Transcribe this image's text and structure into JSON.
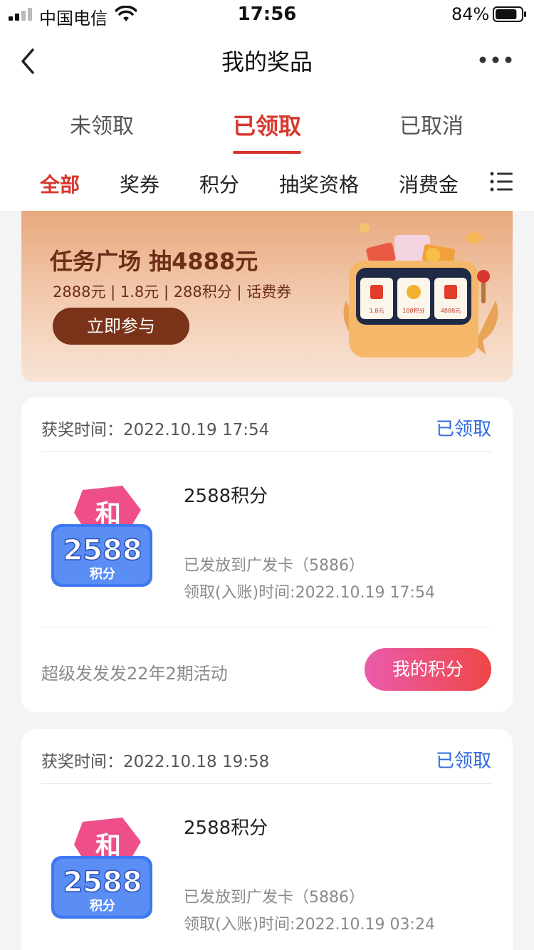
{
  "status_bar": {
    "carrier": "中国电信",
    "time": "17:56",
    "battery_pct": "84%",
    "battery_level": 0.84
  },
  "nav": {
    "title": "我的奖品",
    "back_icon": "chevron-left-icon",
    "more_icon": "more-horizontal-icon"
  },
  "tabs": [
    {
      "label": "未领取",
      "active": false
    },
    {
      "label": "已领取",
      "active": true
    },
    {
      "label": "已取消",
      "active": false
    }
  ],
  "filters": [
    {
      "label": "全部",
      "active": true
    },
    {
      "label": "奖券",
      "active": false
    },
    {
      "label": "积分",
      "active": false
    },
    {
      "label": "抽奖资格",
      "active": false
    },
    {
      "label": "消费金",
      "active": false
    }
  ],
  "banner": {
    "title": "任务广场 抽4888元",
    "subtitle": "2888元 | 1.8元 | 288积分 | 话费券",
    "button_label": "立即参与",
    "machine_labels": [
      "1.8元",
      "188积分",
      "4888元"
    ]
  },
  "cards": [
    {
      "time_label": "获奖时间：",
      "time": "2022.10.19 17:54",
      "status": "已领取",
      "icon_badge": "和",
      "icon_number": "2588",
      "icon_unit": "积分",
      "prize_title": "2588积分",
      "issued_to": "已发放到广发卡（5886）",
      "receive_time": "领取(入账)时间:2022.10.19 17:54",
      "activity": "超级发发发22年2期活动",
      "button_label": "我的积分"
    },
    {
      "time_label": "获奖时间：",
      "time": "2022.10.18 19:58",
      "status": "已领取",
      "icon_badge": "和",
      "icon_number": "2588",
      "icon_unit": "积分",
      "prize_title": "2588积分",
      "issued_to": "已发放到广发卡（5886）",
      "receive_time": "领取(入账)时间:2022.10.19 03:24"
    }
  ],
  "colors": {
    "accent_red": "#d8372e",
    "status_blue": "#2f6ae0",
    "banner_button": "#7a3319"
  }
}
